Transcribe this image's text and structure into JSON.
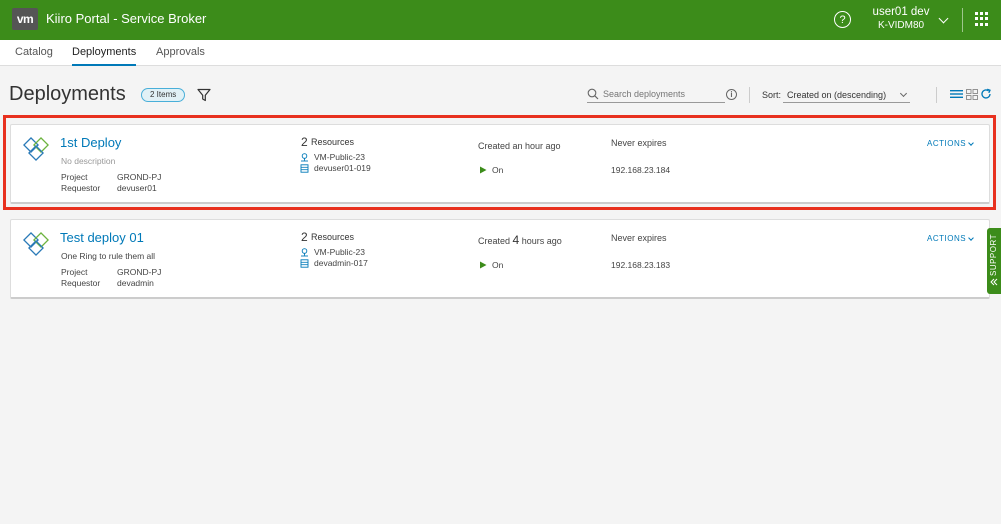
{
  "header": {
    "logo_text": "vm",
    "title": "Kiiro Portal - Service Broker",
    "user_name": "user01 dev",
    "user_tenant": "K-VIDM80",
    "help_icon": "question-circle-icon",
    "apps_icon": "grid-apps-icon"
  },
  "nav": {
    "tabs": [
      {
        "label": "Catalog",
        "active": false
      },
      {
        "label": "Deployments",
        "active": true
      },
      {
        "label": "Approvals",
        "active": false
      }
    ]
  },
  "page": {
    "title": "Deployments",
    "count_badge": "2 Items",
    "search_placeholder": "Search deployments",
    "sort_label": "Sort:",
    "sort_value": "Created on (descending)"
  },
  "deployments": [
    {
      "name": "1st Deploy",
      "description": "No description",
      "project_label": "Project",
      "project": "GROND-PJ",
      "requestor_label": "Requestor",
      "requestor": "devuser01",
      "resource_count": "2",
      "resources_label": "Resources",
      "resources": [
        "VM-Public-23",
        "devuser01-019"
      ],
      "created_prefix": "Created an hour ago",
      "created_number": "",
      "created_suffix": "",
      "power": "On",
      "expires": "Never expires",
      "ip": "192.168.23.184",
      "actions": "ACTIONS"
    },
    {
      "name": "Test deploy 01",
      "description": "One Ring to rule them all",
      "project_label": "Project",
      "project": "GROND-PJ",
      "requestor_label": "Requestor",
      "requestor": "devadmin",
      "resource_count": "2",
      "resources_label": "Resources",
      "resources": [
        "VM-Public-23",
        "devadmin-017"
      ],
      "created_prefix": "Created ",
      "created_number": "4",
      "created_suffix": " hours ago",
      "power": "On",
      "expires": "Never expires",
      "ip": "192.168.23.183",
      "actions": "ACTIONS"
    }
  ],
  "support": {
    "label": "SUPPORT"
  },
  "colors": {
    "header": "#3c8c1a",
    "accent": "#0079b8",
    "highlight": "#e8311f",
    "badge_border": "#49afd9"
  }
}
